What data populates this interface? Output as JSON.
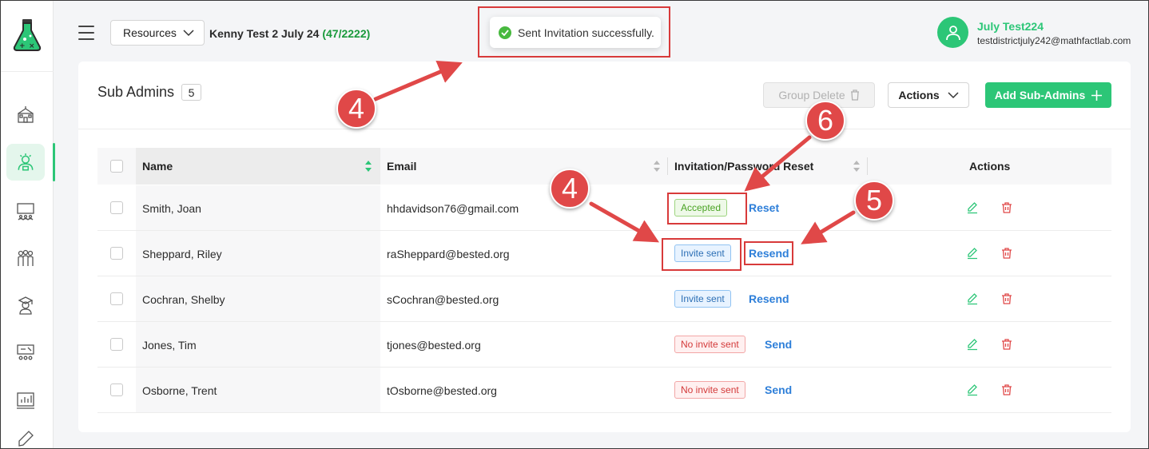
{
  "topbar": {
    "resources_label": "Resources",
    "district_name": "Kenny Test 2 July 24",
    "district_count": "(47/2222)"
  },
  "toast": {
    "message": "Sent Invitation successfully."
  },
  "user": {
    "name": "July Test224",
    "email": "testdistrictjuly242@mathfactlab.com"
  },
  "sidebar": {
    "items": [
      {
        "icon": "school-icon"
      },
      {
        "icon": "sub-admin-icon",
        "active": true
      },
      {
        "icon": "classroom-icon"
      },
      {
        "icon": "users-group-icon"
      },
      {
        "icon": "student-graduate-icon"
      },
      {
        "icon": "class-board-icon"
      },
      {
        "icon": "reports-chart-icon"
      },
      {
        "icon": "edit-icon"
      }
    ]
  },
  "card": {
    "title": "Sub Admins",
    "count": "5",
    "group_delete_label": "Group Delete",
    "actions_label": "Actions",
    "add_label": "Add Sub-Admins"
  },
  "table": {
    "headers": {
      "name": "Name",
      "email": "Email",
      "invitation": "Invitation/Password Reset",
      "actions": "Actions"
    },
    "rows": [
      {
        "name": "Smith, Joan",
        "email": "hhdavidson76@gmail.com",
        "status": "Accepted",
        "action": "Reset"
      },
      {
        "name": "Sheppard, Riley",
        "email": "raSheppard@bested.org",
        "status": "Invite sent",
        "action": "Resend"
      },
      {
        "name": "Cochran, Shelby",
        "email": "sCochran@bested.org",
        "status": "Invite sent",
        "action": "Resend"
      },
      {
        "name": "Jones, Tim",
        "email": "tjones@bested.org",
        "status": "No invite sent",
        "action": "Send"
      },
      {
        "name": "Osborne, Trent",
        "email": "tOsborne@bested.org",
        "status": "No invite sent",
        "action": "Send"
      }
    ]
  },
  "annotations": {
    "callout_toast": "4",
    "callout_status": "4",
    "callout_resend": "5",
    "callout_reset": "6"
  },
  "colors": {
    "brand_green": "#2cc677",
    "annotation_red": "#d83a3a",
    "link_blue": "#2e7fd9"
  }
}
